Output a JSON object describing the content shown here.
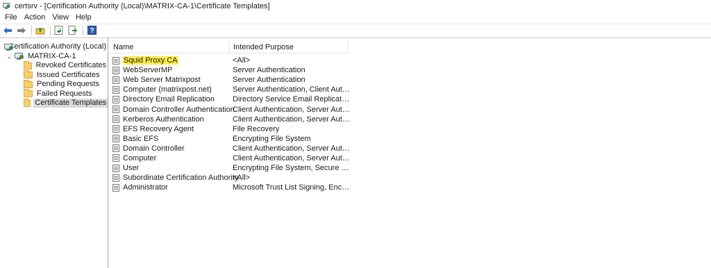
{
  "window": {
    "title": "certsrv - [Certification Authority (Local)\\MATRIX-CA-1\\Certificate Templates]",
    "app_icon": "certsrv-icon"
  },
  "menu": [
    "File",
    "Action",
    "View",
    "Help"
  ],
  "toolbar": {
    "buttons": [
      "back-arrow-icon",
      "forward-arrow-icon",
      "up-folder-icon",
      "refresh-icon",
      "export-list-icon",
      "help-icon"
    ]
  },
  "tree": {
    "root": "Certification Authority (Local)",
    "ca": "MATRIX-CA-1",
    "folders": [
      "Revoked Certificates",
      "Issued Certificates",
      "Pending Requests",
      "Failed Requests",
      "Certificate Templates"
    ],
    "selected": "Certificate Templates"
  },
  "list": {
    "columns": {
      "name": "Name",
      "purpose": "Intended Purpose"
    },
    "highlight_color": "#ffe94a",
    "rows": [
      {
        "name": "Squid Proxy CA",
        "purpose": "<All>"
      },
      {
        "name": "WebServerMP",
        "purpose": "Server Authentication"
      },
      {
        "name": "Web Server Matrixpost",
        "purpose": "Server Authentication"
      },
      {
        "name": "Computer (matrixpost.net)",
        "purpose": "Server Authentication, Client Authentic..."
      },
      {
        "name": "Directory Email Replication",
        "purpose": "Directory Service Email Replication"
      },
      {
        "name": "Domain Controller Authentication",
        "purpose": "Client Authentication, Server Authentic..."
      },
      {
        "name": "Kerberos Authentication",
        "purpose": "Client Authentication, Server Authentic..."
      },
      {
        "name": "EFS Recovery Agent",
        "purpose": "File Recovery"
      },
      {
        "name": "Basic EFS",
        "purpose": "Encrypting File System"
      },
      {
        "name": "Domain Controller",
        "purpose": "Client Authentication, Server Authentic..."
      },
      {
        "name": "Computer",
        "purpose": "Client Authentication, Server Authentic..."
      },
      {
        "name": "User",
        "purpose": "Encrypting File System, Secure Email, Cl..."
      },
      {
        "name": "Subordinate Certification Authority",
        "purpose": "<All>"
      },
      {
        "name": "Administrator",
        "purpose": "Microsoft Trust List Signing, Encrypting ..."
      }
    ]
  }
}
